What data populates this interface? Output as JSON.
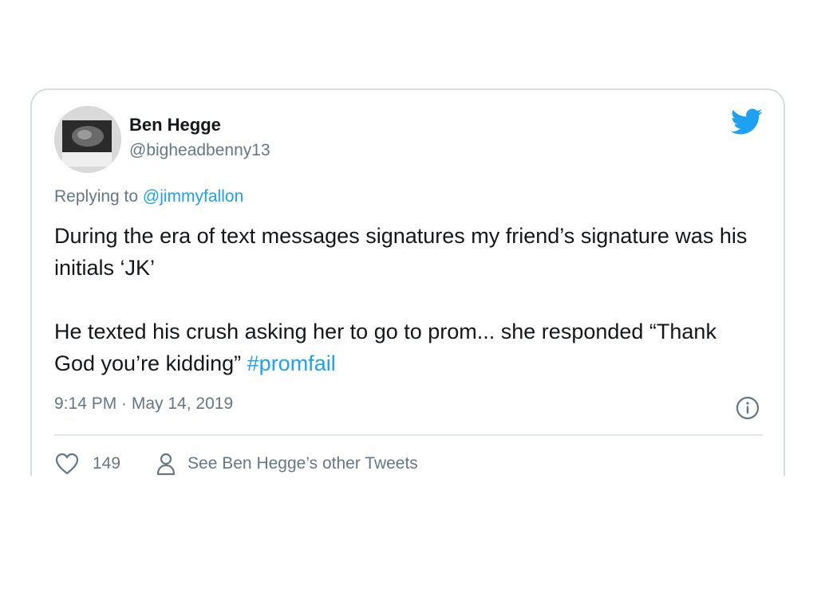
{
  "tweet": {
    "author_name": "Ben Hegge",
    "author_handle": "@bigheadbenny13",
    "reply_prefix": "Replying to ",
    "reply_to": "@jimmyfallon",
    "body_para1": "During the era of text messages signatures my friend’s signature was his initials ‘JK’",
    "body_para2": "He texted his crush asking her to go to prom... she responded “Thank God you’re kidding”",
    "hashtag": "#promfail",
    "timestamp": "9:14 PM · May 14, 2019",
    "like_count": "149",
    "other_tweets_label": "See Ben Hegge’s other Tweets"
  },
  "icons": {
    "brand": "twitter-bird-icon",
    "info": "info-icon",
    "like": "heart-icon",
    "profile": "person-icon"
  },
  "colors": {
    "accent": "#1da1f2",
    "secondary_text": "#657786",
    "primary_text": "#14171a",
    "border": "#d4dde3"
  }
}
